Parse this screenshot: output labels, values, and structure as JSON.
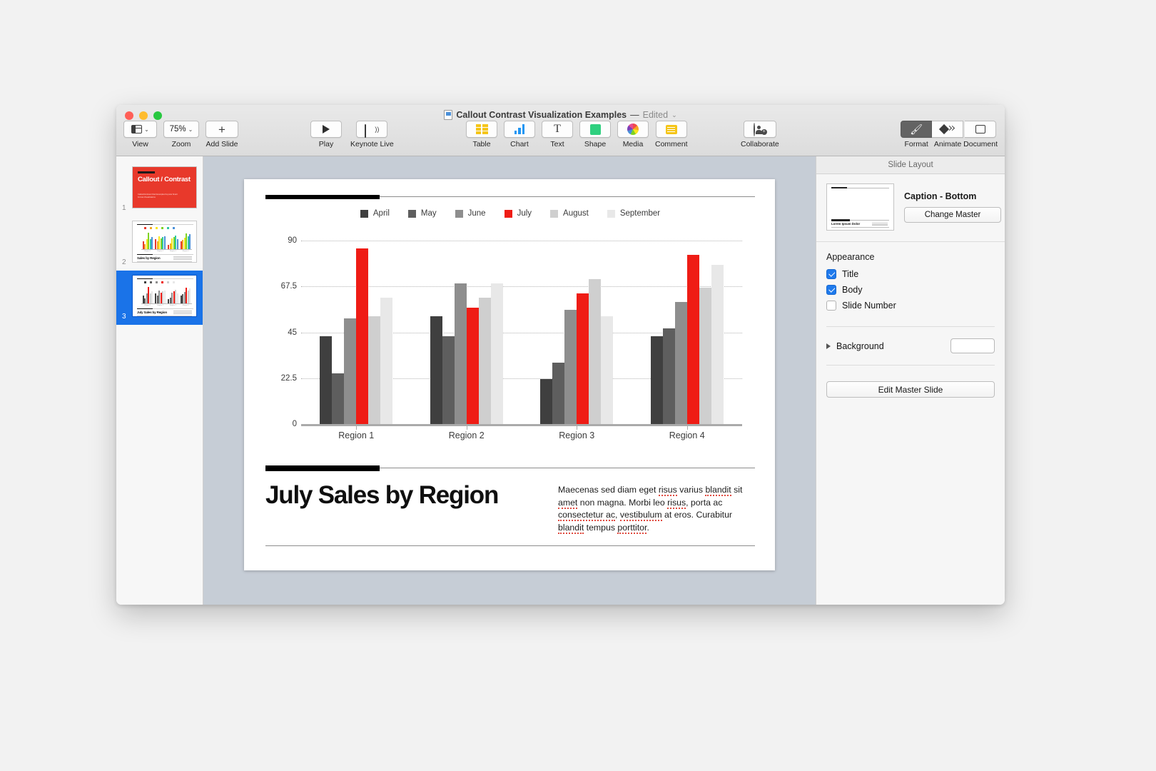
{
  "window": {
    "title": "Callout Contrast Visualization Examples",
    "dash": "—",
    "edited": "Edited",
    "chevron": "⌄"
  },
  "toolbar": {
    "left": [
      {
        "label": "View",
        "icon": "view-panes-icon",
        "chevron": "⌄"
      },
      {
        "label": "Zoom",
        "icon": "zoom-level-icon",
        "value": "75%",
        "chevron": "⌄"
      },
      {
        "label": "Add Slide",
        "icon": "plus-icon"
      }
    ],
    "play": [
      {
        "label": "Play",
        "icon": "play-triangle-icon"
      },
      {
        "label": "Keynote Live",
        "icon": "broadcast-screen-icon"
      }
    ],
    "insert": [
      {
        "label": "Table",
        "icon": "table-grid-icon"
      },
      {
        "label": "Chart",
        "icon": "bar-chart-icon"
      },
      {
        "label": "Text",
        "icon": "text-t-icon"
      },
      {
        "label": "Shape",
        "icon": "shape-square-icon"
      },
      {
        "label": "Media",
        "icon": "media-photos-icon"
      },
      {
        "label": "Comment",
        "icon": "comment-note-icon"
      }
    ],
    "collaborate": {
      "label": "Collaborate",
      "icon": "collaborate-person-add-icon"
    },
    "right": [
      {
        "label": "Format",
        "icon": "format-paintbrush-icon",
        "active": true
      },
      {
        "label": "Animate",
        "icon": "animate-diamond-icon",
        "active": false
      },
      {
        "label": "Document",
        "icon": "document-rect-icon",
        "active": false
      }
    ]
  },
  "navigator": {
    "slides": [
      {
        "number": "1",
        "type": "title",
        "title": "Callout /\nContrast",
        "subtitle": "Callout/Contrast Chart Examples\nKeynote Smart Format Visualizations",
        "selected": false
      },
      {
        "number": "2",
        "type": "chart",
        "title": "Sales by Region",
        "selected": false
      },
      {
        "number": "3",
        "type": "chart",
        "title": "July Sales by Region",
        "selected": true
      }
    ]
  },
  "slide": {
    "title": "July Sales by Region",
    "body_parts": [
      {
        "t": "Maecenas sed diam eget ",
        "sp": false
      },
      {
        "t": "risus",
        "sp": true
      },
      {
        "t": " varius ",
        "sp": false
      },
      {
        "t": "blandit",
        "sp": true
      },
      {
        "t": " sit ",
        "sp": false
      },
      {
        "t": "amet",
        "sp": true
      },
      {
        "t": " non magna. Morbi leo ",
        "sp": false
      },
      {
        "t": "risus",
        "sp": true
      },
      {
        "t": ", porta ac ",
        "sp": false
      },
      {
        "t": "consectetur ac",
        "sp": true
      },
      {
        "t": ", ",
        "sp": false
      },
      {
        "t": "vestibulum",
        "sp": true
      },
      {
        "t": " at eros. Curabitur ",
        "sp": false
      },
      {
        "t": "blandit",
        "sp": true
      },
      {
        "t": " tempus ",
        "sp": false
      },
      {
        "t": "porttitor",
        "sp": true
      },
      {
        "t": ".",
        "sp": false
      }
    ]
  },
  "chart_data": {
    "type": "bar",
    "title": "July Sales by Region",
    "xlabel": "",
    "ylabel": "",
    "ylim": [
      0,
      90
    ],
    "yticks": [
      "0",
      "22.5",
      "45",
      "67.5",
      "90"
    ],
    "ytick_values": [
      0,
      22.5,
      45,
      67.5,
      90
    ],
    "grid": true,
    "legend_position": "top-center",
    "categories": [
      "Region 1",
      "Region 2",
      "Region 3",
      "Region 4"
    ],
    "series": [
      {
        "name": "April",
        "color": "#3f3f3f",
        "values": [
          43,
          53,
          22,
          43
        ]
      },
      {
        "name": "May",
        "color": "#5e5e5e",
        "values": [
          25,
          43,
          30,
          47
        ]
      },
      {
        "name": "June",
        "color": "#8e8e8e",
        "values": [
          52,
          69,
          56,
          60
        ]
      },
      {
        "name": "July",
        "color": "#ef1c15",
        "values": [
          86,
          57,
          64,
          83
        ],
        "highlight": true
      },
      {
        "name": "August",
        "color": "#cfcfcf",
        "values": [
          53,
          62,
          71,
          67
        ]
      },
      {
        "name": "September",
        "color": "#e8e8e8",
        "values": [
          62,
          69,
          53,
          78
        ]
      }
    ]
  },
  "inspector": {
    "header": "Slide Layout",
    "master_name": "Caption - Bottom",
    "change_master_label": "Change Master",
    "master_thumb_title": "Lorem Ipsum Dolor",
    "appearance_title": "Appearance",
    "appearance_options": [
      {
        "label": "Title",
        "checked": true
      },
      {
        "label": "Body",
        "checked": true
      },
      {
        "label": "Slide Number",
        "checked": false
      }
    ],
    "background_label": "Background",
    "background_color": "#ffffff",
    "edit_master_label": "Edit Master Slide"
  }
}
